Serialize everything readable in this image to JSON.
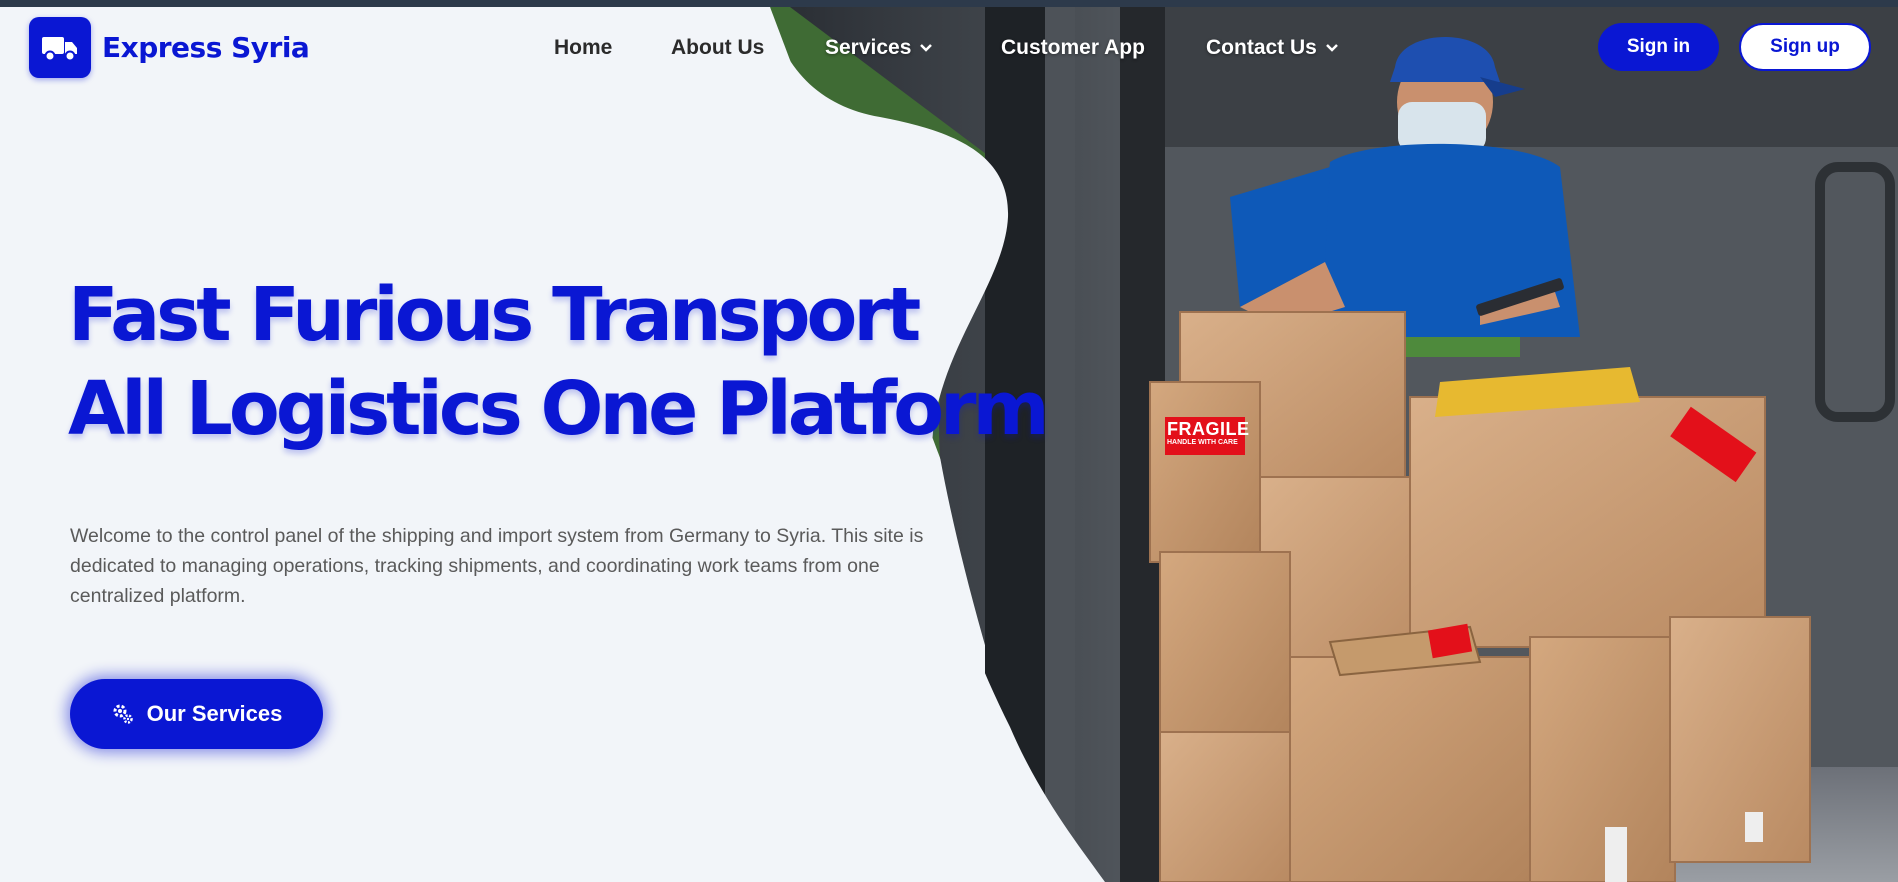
{
  "brand": {
    "name": "Express Syria",
    "icon": "truck-icon",
    "color": "#0a17d3"
  },
  "nav": {
    "items": [
      {
        "label": "Home"
      },
      {
        "label": "About Us"
      },
      {
        "label": "Services",
        "has_dropdown": true
      },
      {
        "label": "Customer App"
      },
      {
        "label": "Contact Us",
        "has_dropdown": true
      }
    ]
  },
  "auth": {
    "sign_in": "Sign in",
    "sign_up": "Sign up"
  },
  "hero": {
    "headline_line1": "Fast Furious Transport",
    "headline_line2": "All Logistics One Platform",
    "description": "Welcome to the control panel of the shipping and import system from Germany to Syria. This site is dedicated to managing operations, tracking shipments, and coordinating work teams from one centralized platform.",
    "cta_label": "Our Services",
    "cta_icon": "gears-icon",
    "sticker_text": "FRAGILE",
    "sticker_subtext": "HANDLE WITH CARE"
  },
  "colors": {
    "accent": "#0a17d3",
    "background": "#f2f5f9",
    "topbar": "#2d3a4b"
  }
}
